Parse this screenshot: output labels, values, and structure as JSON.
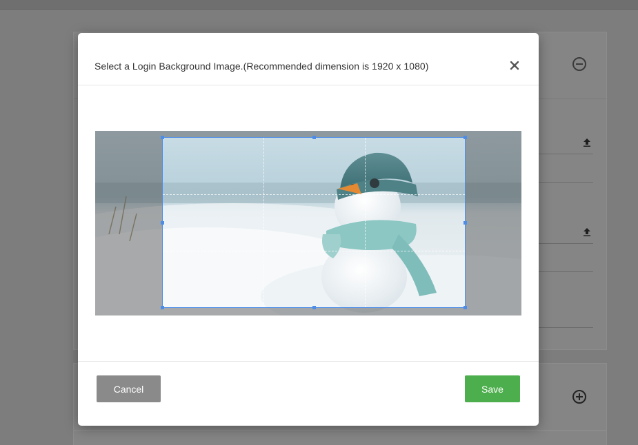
{
  "modal": {
    "title": "Select a Login Background Image.(Recommended dimension is 1920 x 1080)",
    "close_icon": "close-icon",
    "cancel_label": "Cancel",
    "save_label": "Save"
  },
  "cropper": {
    "image_subject": "snowman-with-teal-hat-and-scarf",
    "crop_box_color": "#4d8de8"
  },
  "background": {
    "collapse_icon": "minus-circle-icon",
    "expand_icon": "plus-circle-icon",
    "upload_icon": "upload-icon"
  },
  "colors": {
    "save": "#4cae4c",
    "cancel": "#8a8a8a",
    "overlay": "#7d7d7d"
  }
}
